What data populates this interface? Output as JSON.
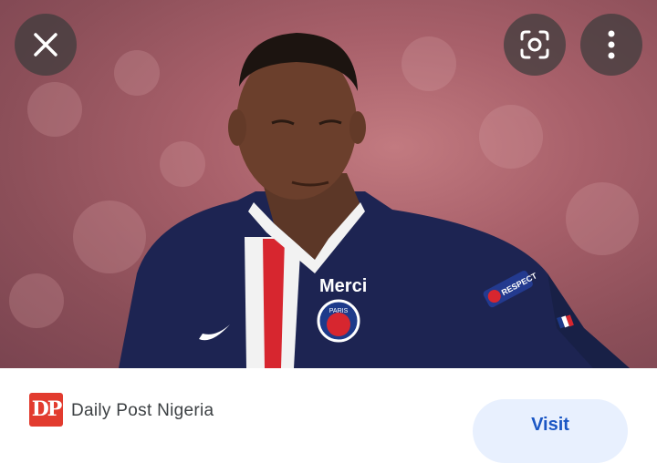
{
  "image": {
    "alt": "Football player in navy blue jersey",
    "jersey_sponsor": "Merci",
    "badge_text": "PARIS",
    "sleeve_patch": "RESPECT"
  },
  "toolbar": {
    "close_icon": "close-icon",
    "lens_icon": "lens-icon",
    "more_icon": "more-vert-icon"
  },
  "source": {
    "logo_text": "DP",
    "name": "Daily Post Nigeria",
    "visit_label": "Visit"
  },
  "colors": {
    "logo_bg": "#e23b2e",
    "visit_bg": "#e8f0fe",
    "visit_text": "#1a56c4",
    "jersey": "#1d2452"
  }
}
